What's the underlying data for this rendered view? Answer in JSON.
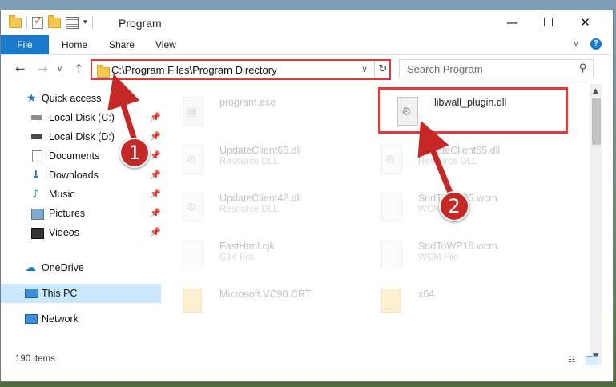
{
  "window": {
    "title": "Program",
    "controls": {
      "minimize": "—",
      "maximize": "☐",
      "close": "✕"
    }
  },
  "ribbon": {
    "file_tab": "File",
    "tabs": [
      "Home",
      "Share",
      "View"
    ]
  },
  "navigation": {
    "address": "C:\\Program Files\\Program Directory",
    "search_placeholder": "Search Program"
  },
  "sidebar": {
    "items": [
      {
        "label": "Quick access",
        "icon": "star-icon"
      },
      {
        "label": "Local Disk (C:)",
        "icon": "drive-icon",
        "pinned": true
      },
      {
        "label": "Local Disk (D:)",
        "icon": "drive-icon",
        "pinned": true
      },
      {
        "label": "Documents",
        "icon": "documents-icon",
        "pinned": true
      },
      {
        "label": "Downloads",
        "icon": "download-icon",
        "pinned": true
      },
      {
        "label": "Music",
        "icon": "music-icon",
        "pinned": true
      },
      {
        "label": "Pictures",
        "icon": "pictures-icon",
        "pinned": true
      },
      {
        "label": "Videos",
        "icon": "videos-icon",
        "pinned": true
      },
      {
        "label": "OneDrive",
        "icon": "cloud-icon"
      },
      {
        "label": "This PC",
        "icon": "computer-icon",
        "selected": true
      },
      {
        "label": "Network",
        "icon": "network-icon"
      }
    ]
  },
  "files": [
    {
      "name": "program.exe",
      "type": "",
      "faded": true
    },
    {
      "name": "libwall_plugin.dll",
      "type": "",
      "faded": false
    },
    {
      "name": "UpdateClient65.dll",
      "type": "Resource DLL",
      "faded": true
    },
    {
      "name": "UpdateClient65.dll",
      "type": "Resource DLL",
      "faded": true
    },
    {
      "name": "UpdateClient42.dll",
      "type": "Resource DLL",
      "faded": true
    },
    {
      "name": "SndToWP85.wcm",
      "type": "WCM File",
      "faded": true
    },
    {
      "name": "FastHtml.cjk",
      "type": "CJK File",
      "faded": true
    },
    {
      "name": "SndToWP16.wcm",
      "type": "WCM File",
      "faded": true
    },
    {
      "name": "Microsoft.VC90.CRT",
      "type": "",
      "faded": true
    },
    {
      "name": "x64",
      "type": "",
      "faded": true
    }
  ],
  "status": {
    "item_count": "190 items"
  },
  "callouts": {
    "step1": "1",
    "step2": "2"
  },
  "colors": {
    "accent": "#1979ca",
    "callout": "#c62828",
    "highlight_border": "#e53935",
    "selection": "#cce8ff"
  }
}
